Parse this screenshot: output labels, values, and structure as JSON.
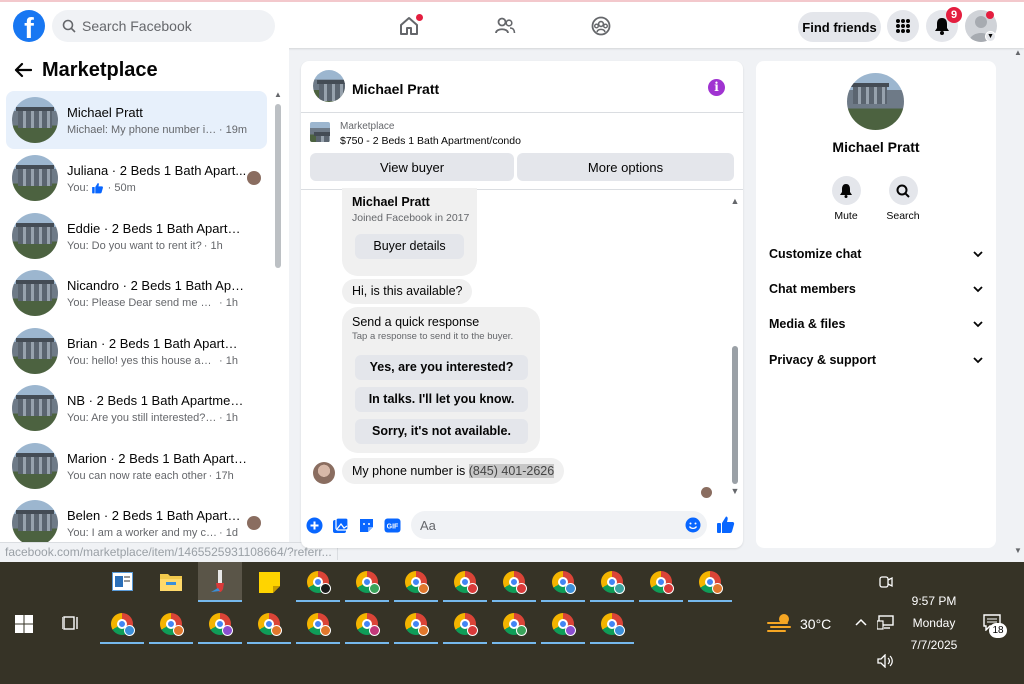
{
  "topbar": {
    "search_placeholder": "Search Facebook",
    "find_friends": "Find friends",
    "notifications_count": "9"
  },
  "marketplace": {
    "title": "Marketplace",
    "conversations": [
      {
        "name": "Michael Pratt",
        "preview": "Michael: My phone number is (8...",
        "time": "· 19m",
        "active": true
      },
      {
        "name": "Juliana · 2 Beds 1 Bath Apart...",
        "preview": "You: ",
        "like": true,
        "time": "· 50m"
      },
      {
        "name": "Eddie · 2 Beds 1 Bath Apartmen...",
        "preview": "You: Do you want to rent it?",
        "time": "· 1h"
      },
      {
        "name": "Nicandro · 2 Beds 1 Bath Apart...",
        "preview": "You: Please Dear send me your nu...",
        "time": "· 1h"
      },
      {
        "name": "Brian · 2 Beds 1 Bath Apartment...",
        "preview": "You: hello! yes this house available ...",
        "time": "· 1h"
      },
      {
        "name": "NB · 2 Beds 1 Bath Apartment/c...",
        "preview": "You: Are you still interested? im wa...",
        "time": "· 1h"
      },
      {
        "name": "Marion · 2 Beds 1 Bath Apartme...",
        "preview": "You can now rate each other",
        "time": "· 17h"
      },
      {
        "name": "Belen · 2 Beds 1 Bath Apartm...",
        "preview": "You: I am a worker and my com...",
        "time": "· 1d"
      }
    ]
  },
  "status_url": "facebook.com/marketplace/item/1465525931108664/?referr...",
  "chat": {
    "contact_name": "Michael Pratt",
    "listing_label": "Marketplace",
    "listing_detail": "$750 - 2 Beds 1 Bath Apartment/condo",
    "view_buyer": "View buyer",
    "more_options": "More options",
    "buyer_card_name": "Michael Pratt",
    "buyer_card_joined": "Joined Facebook in 2017",
    "buyer_details": "Buyer details",
    "msg_available": "Hi, is this available?",
    "quick_title": "Send a quick response",
    "quick_subtitle": "Tap a response to send it to the buyer.",
    "quick_options": [
      "Yes, are you interested?",
      "In talks. I'll let you know.",
      "Sorry, it's not available."
    ],
    "msg_phone_prefix": "My phone number is ",
    "msg_phone_number": "(845) 401-2626",
    "input_placeholder": "Aa"
  },
  "right_panel": {
    "name": "Michael Pratt",
    "mute": "Mute",
    "search": "Search",
    "sections": [
      "Customize chat",
      "Chat members",
      "Media & files",
      "Privacy & support"
    ]
  },
  "taskbar": {
    "weather": "30°C",
    "time": "9:57 PM",
    "day": "Monday",
    "date": "7/7/2025",
    "notification_count": "18",
    "chrome_profile_colors_row1": [
      "#1a1a1a",
      "#3aa45b",
      "#e0772c",
      "#d93a3a",
      "#d93a3a",
      "#3b8fd9",
      "#3aa4a0",
      "#d93a3a",
      "#e0772c"
    ],
    "chrome_profile_colors_row2": [
      "#3b8fd9",
      "#e0772c",
      "#8b4fd1",
      "#e0772c",
      "#e0772c",
      "#c2387a",
      "#e0772c",
      "#d93a3a",
      "#3aa45b",
      "#8b4fd1",
      "#3b8fd9"
    ]
  }
}
